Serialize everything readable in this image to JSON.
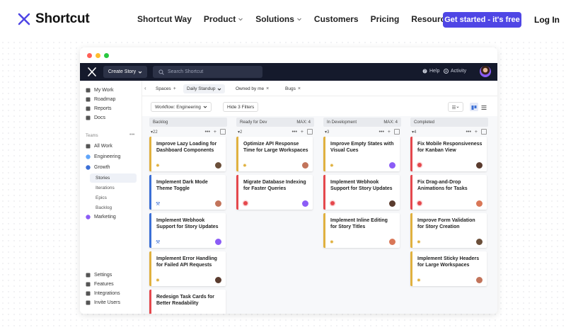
{
  "site": {
    "brand": "Shortcut",
    "nav": [
      {
        "label": "Shortcut Way",
        "dropdown": false
      },
      {
        "label": "Product",
        "dropdown": true
      },
      {
        "label": "Solutions",
        "dropdown": true
      },
      {
        "label": "Customers",
        "dropdown": false
      },
      {
        "label": "Pricing",
        "dropdown": false
      },
      {
        "label": "Resources",
        "dropdown": true
      }
    ],
    "cta": "Get started - it's free",
    "login": "Log In",
    "accent": "#4f46e5"
  },
  "app": {
    "create_story": "Create Story",
    "search_placeholder": "Search Shortcut",
    "help": "Help",
    "activity": "Activity",
    "sidebar": {
      "top_items": [
        {
          "label": "My Work",
          "icon": "user-icon"
        },
        {
          "label": "Roadmap",
          "icon": "roadmap-icon"
        },
        {
          "label": "Reports",
          "icon": "reports-icon"
        },
        {
          "label": "Docs",
          "icon": "docs-icon"
        }
      ],
      "teams_label": "Teams",
      "teams": [
        {
          "label": "All Work",
          "icon": "all-work-icon"
        },
        {
          "label": "Engineering",
          "icon": "team-dot-icon"
        },
        {
          "label": "Growth",
          "icon": "team-dot-icon"
        }
      ],
      "growth_sub": [
        "Stories",
        "Iterations",
        "Epics",
        "Backlog"
      ],
      "marketing": "Marketing",
      "bottom_items": [
        {
          "label": "Settings",
          "icon": "gear-icon"
        },
        {
          "label": "Features",
          "icon": "features-icon"
        },
        {
          "label": "Integrations",
          "icon": "integrations-icon"
        },
        {
          "label": "Invite Users",
          "icon": "invite-icon"
        }
      ]
    },
    "tabs": {
      "spaces": "Spaces",
      "items": [
        "Daily Standup",
        "Owned by me",
        "Bugs"
      ]
    },
    "toolbar": {
      "workflow": "Workflow: Engineering",
      "hide_filters": "Hide 3 Filters"
    },
    "columns": [
      {
        "name": "Backlog",
        "max": "",
        "count": "22",
        "cards": [
          {
            "title": "Improve Lazy Loading for Dashboard Components",
            "type": "feature",
            "bar": "#e0b13f"
          },
          {
            "title": "Implement Dark Mode Theme Toggle",
            "type": "chore",
            "bar": "#3b6fd6"
          },
          {
            "title": "Implement Webhook Support for Story Updates",
            "type": "chore",
            "bar": "#3b6fd6"
          },
          {
            "title": "Implement Error Handling for Failed API Requests",
            "type": "feature",
            "bar": "#e0b13f"
          },
          {
            "title": "Redesign Task Cards for Better Readability",
            "type": "bug",
            "bar": "#e5484d"
          }
        ]
      },
      {
        "name": "Ready for Dev",
        "max": "MAX: 4",
        "count": "2",
        "cards": [
          {
            "title": "Optimize API Response Time for Large Workspaces",
            "type": "feature",
            "bar": "#e0b13f"
          },
          {
            "title": "Migrate Database Indexing for Faster Queries",
            "type": "bug",
            "bar": "#e5484d"
          }
        ]
      },
      {
        "name": "In Development",
        "max": "MAX: 4",
        "count": "3",
        "cards": [
          {
            "title": "Improve Empty States with Visual Cues",
            "type": "feature",
            "bar": "#e0b13f"
          },
          {
            "title": "Implement Webhook Support for Story Updates",
            "type": "bug",
            "bar": "#e5484d"
          },
          {
            "title": "Implement Inline Editing for Story Titles",
            "type": "feature",
            "bar": "#e0b13f"
          }
        ]
      },
      {
        "name": "Completed",
        "max": "",
        "count": "4",
        "cards": [
          {
            "title": "Fix Mobile Responsiveness for Kanban View",
            "type": "bug",
            "bar": "#e5484d"
          },
          {
            "title": "Fix Drag-and-Drop Animations for Tasks",
            "type": "bug",
            "bar": "#e5484d"
          },
          {
            "title": "Improve Form Validation for Story Creation",
            "type": "feature",
            "bar": "#e0b13f"
          },
          {
            "title": "Implement Sticky Headers for Large Workspaces",
            "type": "feature",
            "bar": "#e0b13f"
          }
        ]
      }
    ]
  }
}
